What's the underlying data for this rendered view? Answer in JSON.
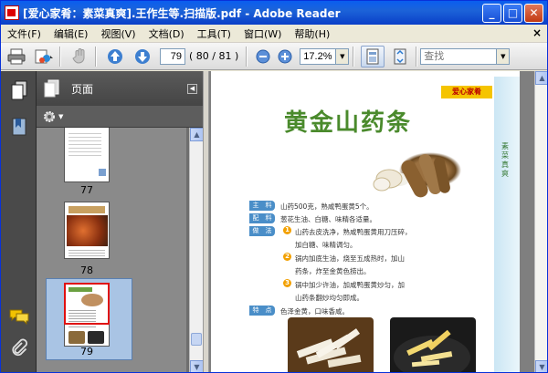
{
  "window": {
    "title": "[爱心家肴：素菜真爽].王作生等.扫描版.pdf - Adobe Reader",
    "minimize": "_",
    "maximize": "□",
    "close": "✕"
  },
  "menu": {
    "items": [
      "文件(F)",
      "编辑(E)",
      "视图(V)",
      "文档(D)",
      "工具(T)",
      "窗口(W)",
      "帮助(H)"
    ],
    "close_doc": "×"
  },
  "toolbar": {
    "page_value": "79",
    "page_total": "( 80 / 81 )",
    "zoom_value": "17.2%",
    "find_placeholder": "查找"
  },
  "panel": {
    "title": "页面",
    "thumb_labels": [
      "77",
      "78",
      "79"
    ],
    "selected_index": 2
  },
  "page": {
    "brand": "爱心家肴",
    "title": "黄金山药条",
    "side_text": "素菜真爽",
    "labels": [
      "主　料",
      "配　料",
      "做　法",
      "特　点"
    ],
    "lines": [
      "山药500克，熟咸鸭蛋黄5个。",
      "葱花生油、白糖、味精各适量。",
      "山药去皮洗净，熟咸鸭蛋黄用刀压碎，",
      "加白糖、味精调匀。",
      "锅内加底生油，烧至五成热时，加山",
      "药条，炸至金黄色捞出。",
      "锅中加少许油，加咸鸭蛋黄炒匀，加",
      "山药条翻炒均匀即成。",
      "色泽金黄，口味香咸。"
    ],
    "steps": [
      "1",
      "2",
      "3"
    ]
  },
  "colors": {
    "title_green": "#4a8a2c",
    "label_blue": "#4a8ec8",
    "step_orange": "#f2a000",
    "titlebar_blue": "#0a5ef0"
  }
}
